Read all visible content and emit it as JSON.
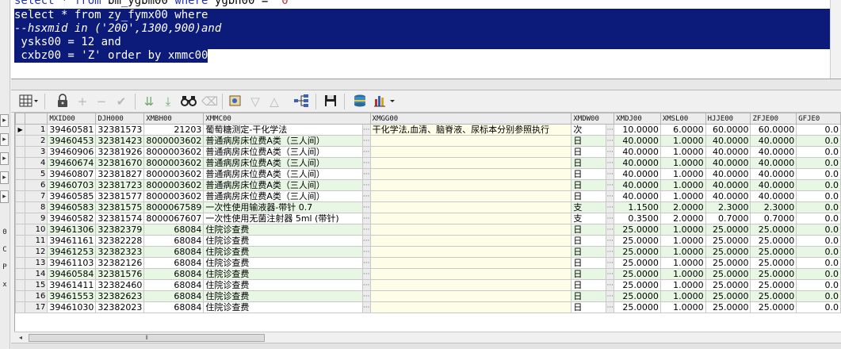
{
  "sql": {
    "line0": {
      "kw1": "select",
      "mid1": " * ",
      "kw2": "from",
      "mid2": " bm_ygbm00 ",
      "kw3": "where",
      "mid3": " ygbh00 = ",
      "str": "'0'"
    },
    "line1": "select * from zy_fymx00 where",
    "line2": "--hsxmid in ('200',1300,900)and",
    "line3": " ysks00 = 12 and",
    "line4": " cxbz00 = 'Z' order by xmmc00"
  },
  "left_gutter": {
    "labels": [
      "0",
      "C",
      "P",
      "x"
    ]
  },
  "toolbar": {
    "icons": [
      "grid-icon",
      "lock-icon",
      "add-icon",
      "delete-icon",
      "post-icon",
      "down-arrows-icon",
      "down-all-icon",
      "find-icon",
      "clear-icon",
      "query-icon",
      "filter-down-icon",
      "filter-up-icon",
      "tree-icon",
      "save-icon",
      "export-icon",
      "chart-icon"
    ]
  },
  "grid": {
    "columns": [
      "MXID00",
      "DJH000",
      "XMBH00",
      "XMMC00",
      "XMGG00",
      "XMDW00",
      "XMDJ00",
      "XMSL00",
      "HJJE00",
      "ZFJE00",
      "GFJE0"
    ],
    "rows": [
      {
        "no": "1",
        "mxid": "39460581",
        "djh": "32381573",
        "xmbh": "21203",
        "xmmc": "葡萄糖测定-干化学法",
        "xmgg": "干化学法,血清、脑脊液、尿标本分别参照执行",
        "xmdw": "次",
        "xmdj": "10.0000",
        "xmsl": "6.0000",
        "hjje": "60.0000",
        "zfje": "60.0000",
        "gfje": "0.0"
      },
      {
        "no": "2",
        "mxid": "39460453",
        "djh": "32381423",
        "xmbh": "8000003602",
        "xmmc": "普通病房床位费A类（三人间）",
        "xmgg": "",
        "xmdw": "日",
        "xmdj": "40.0000",
        "xmsl": "1.0000",
        "hjje": "40.0000",
        "zfje": "40.0000",
        "gfje": "0.0"
      },
      {
        "no": "3",
        "mxid": "39460906",
        "djh": "32381926",
        "xmbh": "8000003602",
        "xmmc": "普通病房床位费A类（三人间）",
        "xmgg": "",
        "xmdw": "日",
        "xmdj": "40.0000",
        "xmsl": "1.0000",
        "hjje": "40.0000",
        "zfje": "40.0000",
        "gfje": "0.0"
      },
      {
        "no": "4",
        "mxid": "39460674",
        "djh": "32381670",
        "xmbh": "8000003602",
        "xmmc": "普通病房床位费A类（三人间）",
        "xmgg": "",
        "xmdw": "日",
        "xmdj": "40.0000",
        "xmsl": "1.0000",
        "hjje": "40.0000",
        "zfje": "40.0000",
        "gfje": "0.0"
      },
      {
        "no": "5",
        "mxid": "39460807",
        "djh": "32381827",
        "xmbh": "8000003602",
        "xmmc": "普通病房床位费A类（三人间）",
        "xmgg": "",
        "xmdw": "日",
        "xmdj": "40.0000",
        "xmsl": "1.0000",
        "hjje": "40.0000",
        "zfje": "40.0000",
        "gfje": "0.0"
      },
      {
        "no": "6",
        "mxid": "39460703",
        "djh": "32381723",
        "xmbh": "8000003602",
        "xmmc": "普通病房床位费A类（三人间）",
        "xmgg": "",
        "xmdw": "日",
        "xmdj": "40.0000",
        "xmsl": "1.0000",
        "hjje": "40.0000",
        "zfje": "40.0000",
        "gfje": "0.0"
      },
      {
        "no": "7",
        "mxid": "39460585",
        "djh": "32381577",
        "xmbh": "8000003602",
        "xmmc": "普通病房床位费A类（三人间）",
        "xmgg": "",
        "xmdw": "日",
        "xmdj": "40.0000",
        "xmsl": "1.0000",
        "hjje": "40.0000",
        "zfje": "40.0000",
        "gfje": "0.0"
      },
      {
        "no": "8",
        "mxid": "39460583",
        "djh": "32381575",
        "xmbh": "8000067589",
        "xmmc": "一次性使用输液器-带针 0.7",
        "xmgg": "",
        "xmdw": "支",
        "xmdj": "1.1500",
        "xmsl": "2.0000",
        "hjje": "2.3000",
        "zfje": "2.3000",
        "gfje": "0.0"
      },
      {
        "no": "9",
        "mxid": "39460582",
        "djh": "32381574",
        "xmbh": "8000067607",
        "xmmc": "一次性使用无菌注射器  5ml (带针)",
        "xmgg": "",
        "xmdw": "支",
        "xmdj": "0.3500",
        "xmsl": "2.0000",
        "hjje": "0.7000",
        "zfje": "0.7000",
        "gfje": "0.0"
      },
      {
        "no": "10",
        "mxid": "39461306",
        "djh": "32382379",
        "xmbh": "68084",
        "xmmc": "住院诊查费",
        "xmgg": "",
        "xmdw": "日",
        "xmdj": "25.0000",
        "xmsl": "1.0000",
        "hjje": "25.0000",
        "zfje": "25.0000",
        "gfje": "0.0"
      },
      {
        "no": "11",
        "mxid": "39461161",
        "djh": "32382228",
        "xmbh": "68084",
        "xmmc": "住院诊查费",
        "xmgg": "",
        "xmdw": "日",
        "xmdj": "25.0000",
        "xmsl": "1.0000",
        "hjje": "25.0000",
        "zfje": "25.0000",
        "gfje": "0.0"
      },
      {
        "no": "12",
        "mxid": "39461253",
        "djh": "32382323",
        "xmbh": "68084",
        "xmmc": "住院诊查费",
        "xmgg": "",
        "xmdw": "日",
        "xmdj": "25.0000",
        "xmsl": "1.0000",
        "hjje": "25.0000",
        "zfje": "25.0000",
        "gfje": "0.0"
      },
      {
        "no": "13",
        "mxid": "39461103",
        "djh": "32382126",
        "xmbh": "68084",
        "xmmc": "住院诊查费",
        "xmgg": "",
        "xmdw": "日",
        "xmdj": "25.0000",
        "xmsl": "1.0000",
        "hjje": "25.0000",
        "zfje": "25.0000",
        "gfje": "0.0"
      },
      {
        "no": "14",
        "mxid": "39460584",
        "djh": "32381576",
        "xmbh": "68084",
        "xmmc": "住院诊查费",
        "xmgg": "",
        "xmdw": "日",
        "xmdj": "25.0000",
        "xmsl": "1.0000",
        "hjje": "25.0000",
        "zfje": "25.0000",
        "gfje": "0.0"
      },
      {
        "no": "15",
        "mxid": "39461411",
        "djh": "32382460",
        "xmbh": "68084",
        "xmmc": "住院诊查费",
        "xmgg": "",
        "xmdw": "日",
        "xmdj": "25.0000",
        "xmsl": "1.0000",
        "hjje": "25.0000",
        "zfje": "25.0000",
        "gfje": "0.0"
      },
      {
        "no": "16",
        "mxid": "39461553",
        "djh": "32382623",
        "xmbh": "68084",
        "xmmc": "住院诊查费",
        "xmgg": "",
        "xmdw": "日",
        "xmdj": "25.0000",
        "xmsl": "1.0000",
        "hjje": "25.0000",
        "zfje": "25.0000",
        "gfje": "0.0"
      },
      {
        "no": "17",
        "mxid": "39461030",
        "djh": "32382023",
        "xmbh": "68084",
        "xmmc": "住院诊查费",
        "xmgg": "",
        "xmdw": "日",
        "xmdj": "25.0000",
        "xmsl": "1.0000",
        "hjje": "25.0000",
        "zfje": "25.0000",
        "gfje": "0.0"
      }
    ]
  },
  "colors": {
    "selection": "#0c1a7a",
    "keyword": "#1f2fb8",
    "string": "#c03030",
    "row_alt": "#e8f7e4",
    "spec_column": "#fefee8"
  }
}
